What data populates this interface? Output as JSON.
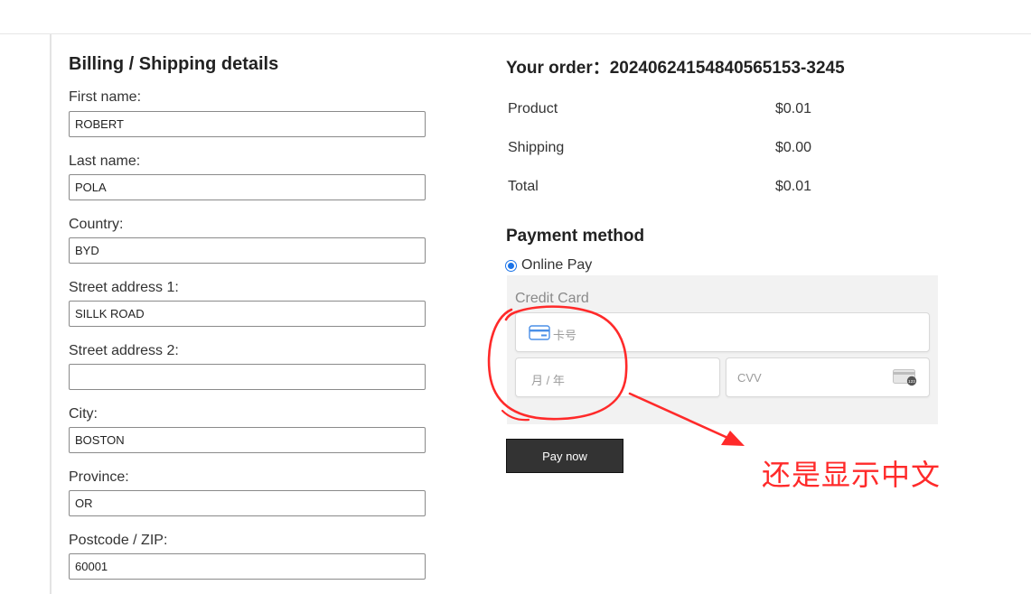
{
  "billing": {
    "title": "Billing / Shipping details",
    "fields": [
      {
        "label": "First name:",
        "value": "ROBERT"
      },
      {
        "label": "Last name:",
        "value": "POLA"
      },
      {
        "label": "Country:",
        "value": "BYD"
      },
      {
        "label": "Street address 1:",
        "value": "SILLK ROAD"
      },
      {
        "label": "Street address 2:",
        "value": ""
      },
      {
        "label": "City:",
        "value": "BOSTON"
      },
      {
        "label": "Province:",
        "value": "OR"
      },
      {
        "label": "Postcode / ZIP:",
        "value": "60001"
      }
    ]
  },
  "order": {
    "title": "Your order：20240624154840565153-3245",
    "rows": [
      {
        "name": "Product",
        "price": "$0.01"
      },
      {
        "name": "Shipping",
        "price": "$0.00"
      },
      {
        "name": "Total",
        "price": "$0.01"
      }
    ]
  },
  "payment": {
    "title": "Payment method",
    "option_label": "Online Pay",
    "card_section_label": "Credit Card",
    "card_number_placeholder": "卡号",
    "expiry_placeholder": "月 / 年",
    "cvv_placeholder": "CVV",
    "pay_button_label": "Pay now"
  },
  "annotation": {
    "text": "还是显示中文",
    "color": "#ff2a2a"
  },
  "colors": {
    "accent": "#1a73e8",
    "button_bg": "#333333",
    "card_panel_bg": "#f2f2f2"
  }
}
